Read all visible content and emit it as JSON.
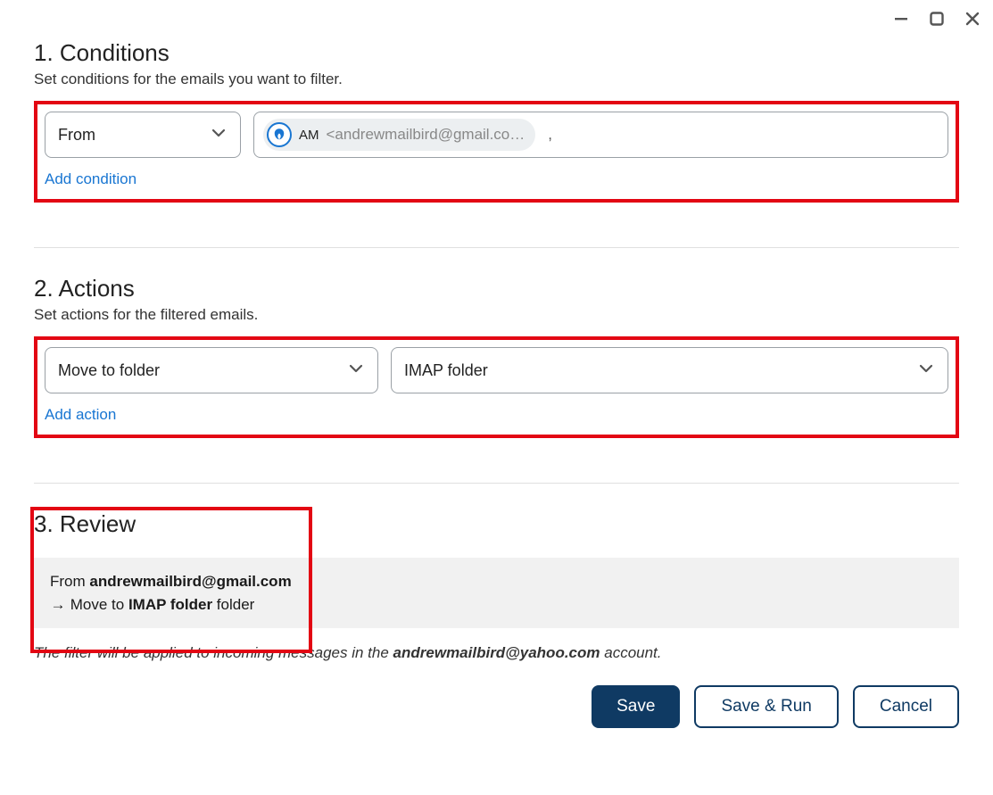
{
  "window": {
    "minimize": "minimize",
    "maximize": "maximize",
    "close": "close"
  },
  "conditions": {
    "title": "1. Conditions",
    "subtitle": "Set conditions for the emails you want to filter.",
    "field_select": "From",
    "chip_initials": "AM",
    "chip_email": "<andrewmailbird@gmail.co…",
    "separator": ",",
    "add_link": "Add condition"
  },
  "actions": {
    "title": "2. Actions",
    "subtitle": "Set actions for the filtered emails.",
    "action_select": "Move to folder",
    "folder_select": "IMAP folder",
    "add_link": "Add action"
  },
  "review": {
    "title": "3. Review",
    "from_prefix": "From ",
    "from_value": "andrewmailbird@gmail.com",
    "move_prefix": "Move to ",
    "move_value": "IMAP folder",
    "move_suffix": " folder",
    "note_prefix": "The filter will be applied to incoming messages in the ",
    "note_account": "andrewmailbird@yahoo.com",
    "note_suffix": " account."
  },
  "buttons": {
    "save": "Save",
    "save_run": "Save & Run",
    "cancel": "Cancel"
  }
}
